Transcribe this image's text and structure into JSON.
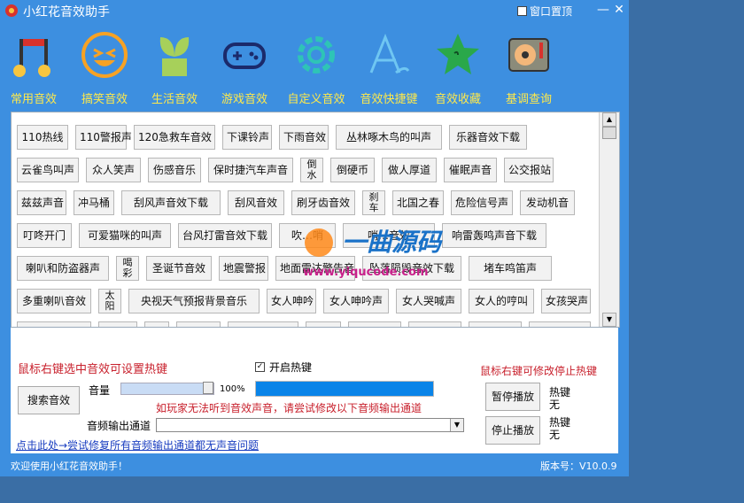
{
  "window": {
    "title": "小红花音效助手",
    "pin_label": "窗口置顶",
    "min_glyph": "—",
    "close_glyph": "✕"
  },
  "nav": [
    {
      "label": "常用音效",
      "icon": "music-note-icon"
    },
    {
      "label": "搞笑音效",
      "icon": "laughing-face-icon"
    },
    {
      "label": "生活音效",
      "icon": "sprout-pot-icon"
    },
    {
      "label": "游戏音效",
      "icon": "gamepad-icon"
    },
    {
      "label": "自定义音效",
      "icon": "gear-icon"
    },
    {
      "label": "音效快捷键",
      "icon": "pen-icon"
    },
    {
      "label": "音效收藏",
      "icon": "star-icon"
    },
    {
      "label": "基调查询",
      "icon": "turntable-icon"
    }
  ],
  "sounds": [
    [
      "110热线",
      "110警报声",
      "120急救车音效",
      "下课铃声",
      "下雨音效",
      "丛林啄木鸟的叫声",
      "乐器音效下载"
    ],
    [
      "云雀鸟叫声",
      "众人笑声",
      "伤感音乐",
      "保时捷汽车声音",
      "倒水",
      "倒硬币",
      "做人厚道",
      "催眠声音",
      "公交报站"
    ],
    [
      "兹兹声音",
      "冲马桶",
      "刮风声音效下载",
      "刮风音效",
      "刷牙齿音效",
      "刹车",
      "北国之春",
      "危险信号声",
      "发动机音"
    ],
    [
      "叮咚开门",
      "可爱猫咪的叫声",
      "台风打雷音效下载",
      "吹…哨",
      "哨…音效",
      "响雷轰鸣声音下载"
    ],
    [
      "喇叭和防盗器声",
      "喝彩",
      "圣诞节音效",
      "地震警报",
      "地面雷达警告音",
      "坠落陨毁音效下载",
      "堵车鸣笛声"
    ],
    [
      "多重喇叭音效",
      "太阳",
      "央视天气预报背景音乐",
      "女人呻吟",
      "女人呻吟声",
      "女人哭喊声",
      "女人的哼叫",
      "女孩哭声"
    ]
  ],
  "controls": {
    "hint_hotkey": "鼠标右键选中音效可设置热键",
    "enable_hotkey": "开启热键",
    "hint_stop": "鼠标右键可修改停止热键",
    "search": "搜索音效",
    "volume_label": "音量",
    "volume_text": "100%",
    "volume": 1.0,
    "progress": 1.0,
    "warning": "如玩家无法听到音效声音，请尝试修改以下音频输出通道",
    "output_label": "音频输出通道",
    "pause": "暂停播放",
    "stop": "停止播放",
    "hotkey_label": "热键",
    "hotkey_none": "无",
    "repair_link": "点击此处→尝试修复所有音频输出通道都无声音问题"
  },
  "status": {
    "welcome": "欢迎使用小红花音效助手！",
    "version": "版本号：V10.0.9"
  },
  "watermark": {
    "brand": "一曲源码",
    "url": "www.yiqucode.com"
  },
  "colors": {
    "window": "#3d8fe0",
    "nav_label": "#ffe94a",
    "warning": "#c8202c",
    "progress": "#0a84e8"
  }
}
